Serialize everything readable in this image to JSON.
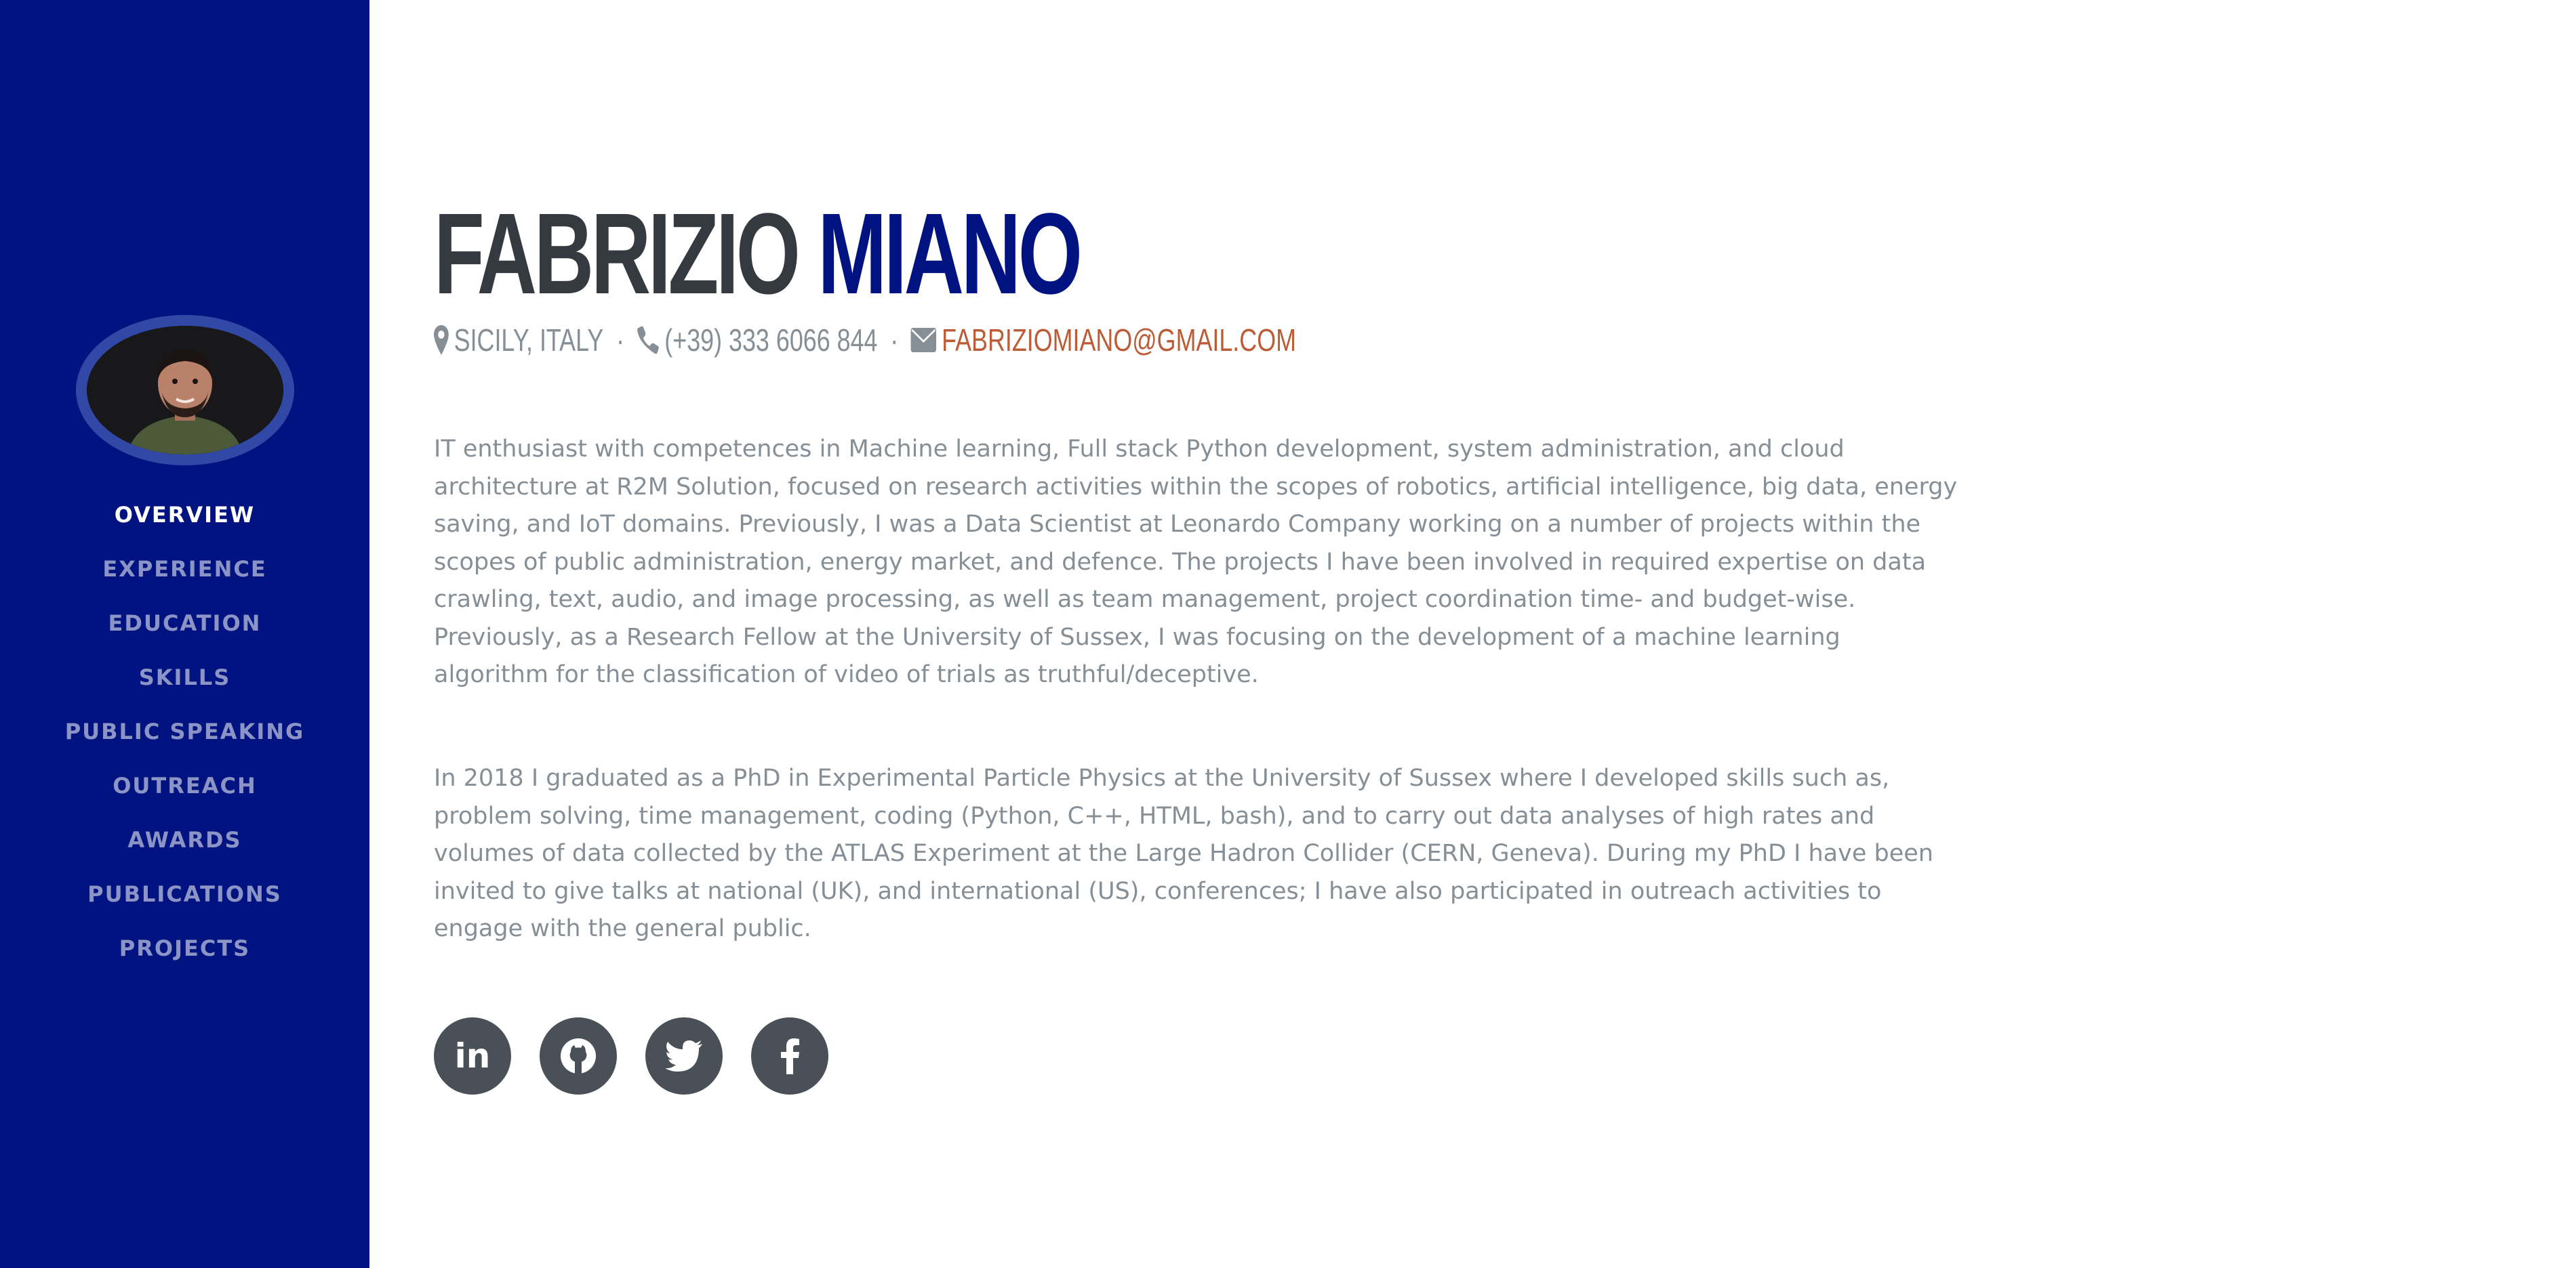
{
  "profile": {
    "first_name": "FABRIZIO",
    "last_name": "MIANO",
    "location": "SICILY, ITALY",
    "phone": "(+39) 333 6066 844",
    "email": "FABRIZIOMIANO@GMAIL.COM",
    "separator": "·"
  },
  "nav": {
    "items": [
      {
        "label": "OVERVIEW",
        "active": true
      },
      {
        "label": "EXPERIENCE"
      },
      {
        "label": "EDUCATION"
      },
      {
        "label": "SKILLS"
      },
      {
        "label": "PUBLIC SPEAKING"
      },
      {
        "label": "OUTREACH"
      },
      {
        "label": "AWARDS"
      },
      {
        "label": "PUBLICATIONS"
      },
      {
        "label": "PROJECTS"
      }
    ]
  },
  "bio": {
    "paragraph_1": "IT enthusiast with competences in Machine learning, Full stack Python development, system administration, and cloud architecture at R2M Solution, focused on research activities within the scopes of robotics, artificial intelligence, big data, energy saving, and IoT domains. Previously, I was a Data Scientist at Leonardo Company working on a number of projects within the scopes of public administration, energy market, and defence. The projects I have been involved in required expertise on data crawling, text, audio, and image processing, as well as team management, project coordination time- and budget-wise. Previously, as a Research Fellow at the University of Sussex, I was focusing on the development of a machine learning algorithm for the classification of video of trials as truthful/deceptive.",
    "paragraph_2": "In 2018 I graduated as a PhD in Experimental Particle Physics at the University of Sussex where I developed skills such as, problem solving, time management, coding (Python, C++, HTML, bash), and to carry out data analyses of high rates and volumes of data collected by the ATLAS Experiment at the Large Hadron Collider (CERN, Geneva). During my PhD I have been invited to give talks at national (UK), and international (US), conferences; I have also participated in outreach activities to engage with the general public."
  },
  "socials": [
    {
      "icon": "linkedin-icon",
      "glyph": "in"
    },
    {
      "icon": "github-icon"
    },
    {
      "icon": "twitter-icon"
    },
    {
      "icon": "facebook-icon"
    }
  ],
  "colors": {
    "sidebar": "#001380",
    "accent": "#bd5d38",
    "heading": "#343a40",
    "text": "#868e96",
    "social_bg": "#495057"
  }
}
